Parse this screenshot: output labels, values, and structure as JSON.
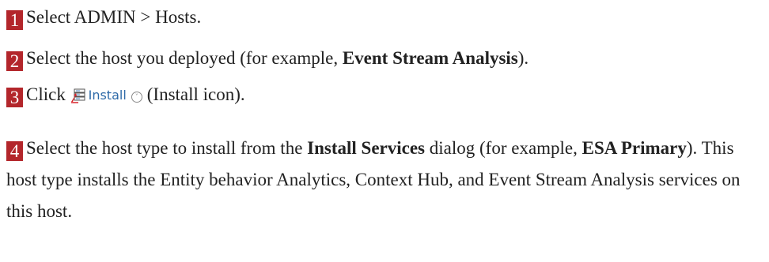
{
  "steps": [
    {
      "num": "1",
      "text": "Select ADMIN > Hosts."
    },
    {
      "num": "2",
      "text_before": "Select the host you deployed (for example, ",
      "bold": "Event Stream Analysis",
      "text_after": ")."
    },
    {
      "num": "3",
      "text_before": "Click",
      "ui_label": "Install",
      "text_after": "(Install icon).",
      "icon": "install-icon"
    },
    {
      "num": "4",
      "text_before": "Select the host type to install from the ",
      "bold1": "Install Services",
      "text_mid": " dialog (for example, ",
      "bold2": "ESA Primary",
      "text_after": "). This host type installs the Entity behavior Analytics, Context Hub, and Event Stream Analysis services on this host."
    }
  ],
  "colors": {
    "badge": "#b3262b",
    "ui_link": "#2e6aa8"
  }
}
